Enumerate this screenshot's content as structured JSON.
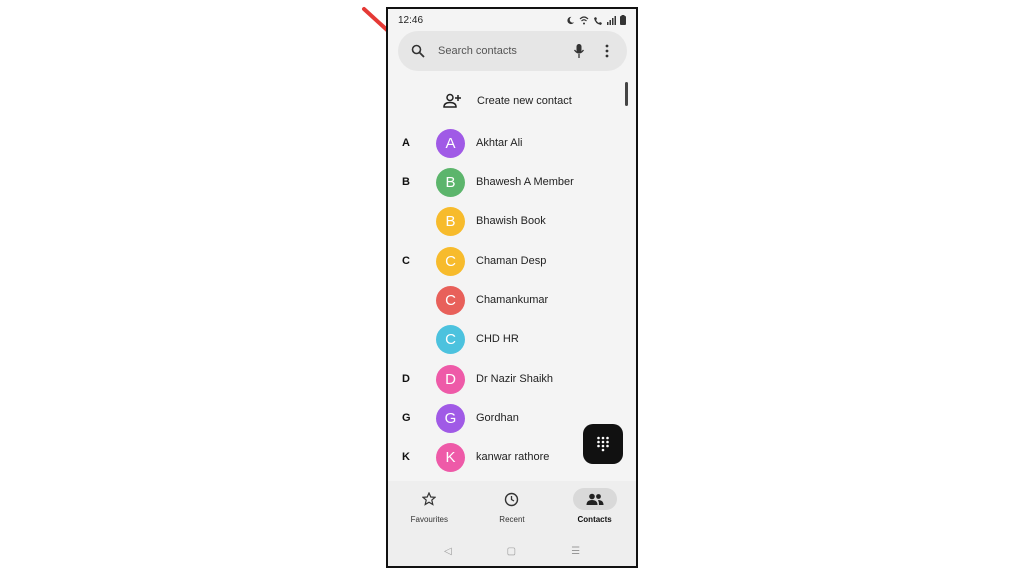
{
  "status_bar": {
    "time": "12:46",
    "icons": [
      "moon-icon",
      "wifi-icon",
      "wifi-calling-icon",
      "signal-icon",
      "battery-icon"
    ]
  },
  "search": {
    "placeholder": "Search contacts",
    "icons": [
      "search-icon",
      "mic-icon",
      "more-vert-icon"
    ]
  },
  "create_contact": {
    "label": "Create new contact",
    "icon": "add-person-icon"
  },
  "contacts": [
    {
      "letter": "A",
      "initial": "A",
      "name": "Akhtar Ali",
      "color": "#a05ae6"
    },
    {
      "letter": "B",
      "initial": "B",
      "name": "Bhawesh A Member",
      "color": "#5cb56c"
    },
    {
      "letter": "",
      "initial": "B",
      "name": "Bhawish Book",
      "color": "#f7bb2c"
    },
    {
      "letter": "C",
      "initial": "C",
      "name": "Chaman Desp",
      "color": "#f7bb2c"
    },
    {
      "letter": "",
      "initial": "C",
      "name": "Chamankumar",
      "color": "#e8605a"
    },
    {
      "letter": "",
      "initial": "C",
      "name": "CHD HR",
      "color": "#4cc2de"
    },
    {
      "letter": "D",
      "initial": "D",
      "name": "Dr Nazir Shaikh",
      "color": "#ee5aa8"
    },
    {
      "letter": "G",
      "initial": "G",
      "name": "Gordhan",
      "color": "#a05ae6"
    },
    {
      "letter": "K",
      "initial": "K",
      "name": "kanwar rathore",
      "color": "#ee5aa8"
    }
  ],
  "fab": {
    "icon": "dialpad-icon"
  },
  "bottom_nav": [
    {
      "label": "Favourites",
      "icon": "star-icon",
      "active": false
    },
    {
      "label": "Recent",
      "icon": "clock-icon",
      "active": false
    },
    {
      "label": "Contacts",
      "icon": "contacts-icon",
      "active": true
    }
  ],
  "system_nav": {
    "back": "◁",
    "home": "▢",
    "recents": "☰"
  },
  "colors": {
    "annotation_arrow": "#e53935"
  }
}
